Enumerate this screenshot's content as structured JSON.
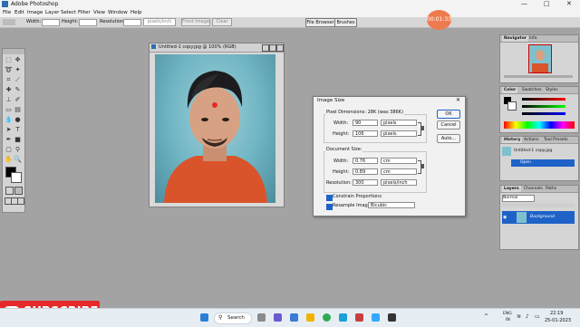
{
  "app": {
    "title": "Adobe Photoshop"
  },
  "window_controls": {
    "minimize": "—",
    "maximize": "□",
    "close": "✕"
  },
  "menu": [
    "File",
    "Edit",
    "Image",
    "Layer",
    "Select",
    "Filter",
    "View",
    "Window",
    "Help"
  ],
  "options_bar": {
    "width_label": "Width:",
    "height_label": "Height:",
    "resolution_label": "Resolution:",
    "unit_value": "pixels/inch",
    "front_image": "Front Image",
    "clear": "Clear",
    "tab_file_browser": "File Browser",
    "tab_brushes": "Brushes"
  },
  "recording_timer": "00:01:33",
  "document": {
    "title": "Untitled-1 copy.jpg @ 100% (RGB)"
  },
  "dialog": {
    "title": "Image Size",
    "close": "✕",
    "pixel_dimensions": "Pixel Dimensions: 28K (was 386K)",
    "width_label": "Width:",
    "width_value": "90",
    "width_unit": "pixels",
    "height_label": "Height:",
    "height_value": "106",
    "height_unit": "pixels",
    "document_size": "Document Size:",
    "doc_width_label": "Width:",
    "doc_width_value": "0.76",
    "doc_width_unit": "cm",
    "doc_height_label": "Height:",
    "doc_height_value": "0.89",
    "doc_height_unit": "cm",
    "resolution_label": "Resolution:",
    "resolution_value": "300",
    "resolution_unit": "pixels/inch",
    "constrain": "Constrain Proportions",
    "resample": "Resample Image:",
    "resample_method": "Bicubic",
    "ok": "OK",
    "cancel": "Cancel",
    "auto": "Auto..."
  },
  "panels": {
    "navigator": {
      "tabs": [
        "Navigator",
        "Info"
      ]
    },
    "color": {
      "tabs": [
        "Color",
        "Swatches",
        "Styles"
      ]
    },
    "history": {
      "tabs": [
        "History",
        "Actions",
        "Tool Presets"
      ],
      "items": [
        "Untitled-1 copy.jpg",
        "Open"
      ]
    },
    "layers": {
      "tabs": [
        "Layers",
        "Channels",
        "Paths"
      ],
      "blend_mode": "Normal",
      "layer_name": "Background"
    }
  },
  "subscribe": "SUBSCRIBE",
  "taskbar": {
    "search": "Search",
    "lang1": "ENG",
    "lang2": "IN",
    "time": "22:19",
    "date": "25-01-2023"
  },
  "colors": {
    "recording": "#ee7b4f",
    "subscribe": "#e52a2a",
    "selection_blue": "#1e62c8"
  }
}
